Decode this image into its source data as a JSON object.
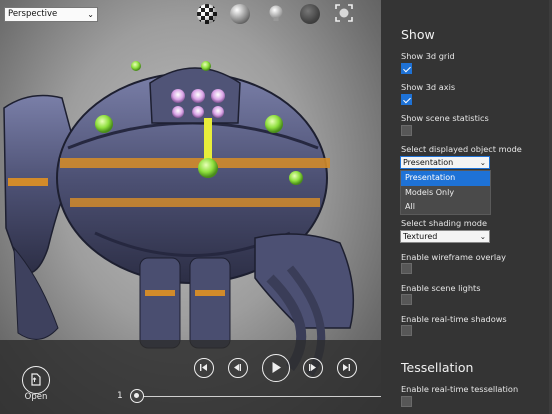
{
  "viewport": {
    "view_mode": "Perspective",
    "toolbar_icons": [
      "checker-texture-icon",
      "sphere-material-icon",
      "light-bulb-icon",
      "dark-sphere-icon",
      "fit-frame-icon"
    ]
  },
  "playback": {
    "open_label": "Open",
    "frame_number": "1",
    "buttons": [
      "skip-to-start-icon",
      "step-back-icon",
      "play-icon",
      "step-forward-icon",
      "skip-to-end-icon"
    ]
  },
  "panel": {
    "show_title": "Show",
    "show_grid_label": "Show 3d grid",
    "show_grid_checked": true,
    "show_axis_label": "Show 3d axis",
    "show_axis_checked": true,
    "show_stats_label": "Show scene statistics",
    "show_stats_checked": false,
    "object_mode_label": "Select displayed object mode",
    "object_mode_value": "Presentation",
    "object_mode_options": [
      "Presentation",
      "Models Only",
      "All"
    ],
    "shading_label": "Select shading mode",
    "shading_value": "Textured",
    "wireframe_label": "Enable wireframe overlay",
    "wireframe_checked": false,
    "lights_label": "Enable scene lights",
    "lights_checked": false,
    "shadows_label": "Enable real-time shadows",
    "shadows_checked": false,
    "tessellation_title": "Tessellation",
    "tessellation_label": "Enable real-time tessellation",
    "tessellation_checked": false
  },
  "colors": {
    "accent": "#1e72d6",
    "panel_bg": "#343434",
    "robot_glow": "#9be84a"
  }
}
